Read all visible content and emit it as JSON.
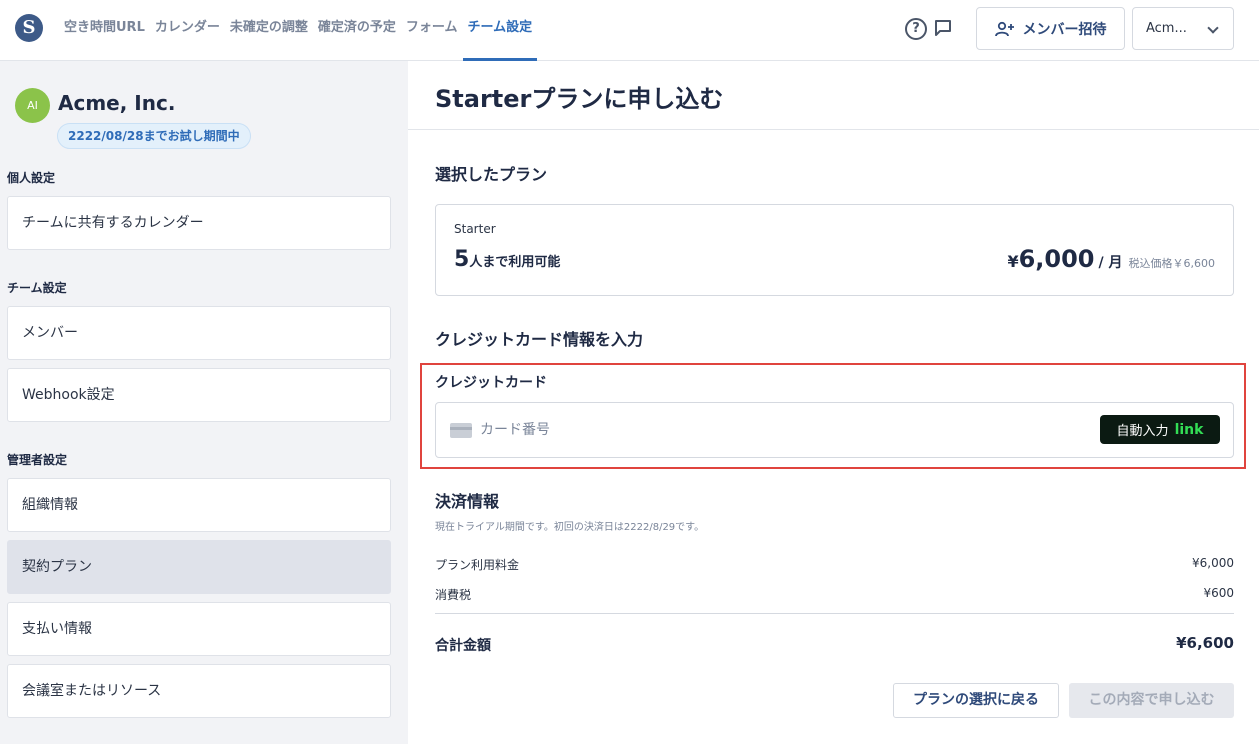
{
  "header": {
    "logo_letter": "S",
    "nav": [
      {
        "label": "空き時間URL"
      },
      {
        "label": "カレンダー"
      },
      {
        "label": "未確定の調整"
      },
      {
        "label": "確定済の予定"
      },
      {
        "label": "フォーム"
      },
      {
        "label": "チーム設定"
      }
    ],
    "active_nav": "チーム設定",
    "help_glyph": "?",
    "invite_label": "メンバー招待",
    "org_selector": "Acm..."
  },
  "sidebar": {
    "avatar_initials": "AI",
    "org_name": "Acme, Inc.",
    "trial_badge": "2222/08/28までお試し期間中",
    "sections": [
      {
        "title": "個人設定",
        "items": [
          {
            "label": "チームに共有するカレンダー"
          }
        ]
      },
      {
        "title": "チーム設定",
        "items": [
          {
            "label": "メンバー"
          },
          {
            "label": "Webhook設定"
          }
        ]
      },
      {
        "title": "管理者設定",
        "items": [
          {
            "label": "組織情報"
          },
          {
            "label": "契約プラン"
          },
          {
            "label": "支払い情報"
          },
          {
            "label": "会議室またはリソース"
          }
        ]
      }
    ],
    "selected_item": "契約プラン"
  },
  "main": {
    "page_title": "Starterプランに申し込む",
    "selected_plan_title": "選択したプラン",
    "plan": {
      "name": "Starter",
      "capacity_num": "5",
      "capacity_text": "人まで利用可能",
      "price_currency": "¥",
      "price_amount": "6,000",
      "price_per": "/ 月",
      "price_tax": "税込価格￥6,600"
    },
    "card_section_title": "クレジットカード情報を入力",
    "card_label": "クレジットカード",
    "card_placeholder": "カード番号",
    "autofill_label": "自動入力",
    "autofill_brand": "link",
    "payment_title": "決済情報",
    "payment_note": "現在トライアル期間です。初回の決済日は2222/8/29です。",
    "rows": [
      {
        "label": "プラン利用料金",
        "value": "¥6,000"
      },
      {
        "label": "消費税",
        "value": "¥600"
      }
    ],
    "total_label": "合計金額",
    "total_value": "¥6,600",
    "back_button": "プランの選択に戻る",
    "submit_button": "この内容で申し込む"
  },
  "colors": {
    "accent": "#2f6cb8",
    "highlight_border": "#e0443e",
    "link_green": "#33dd55"
  }
}
